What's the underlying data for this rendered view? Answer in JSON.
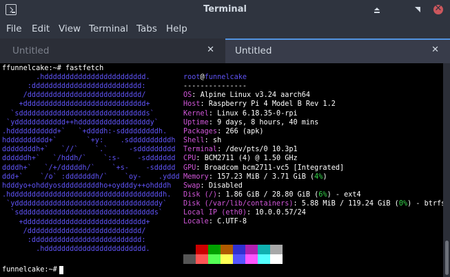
{
  "window": {
    "title": "Terminal"
  },
  "menu": [
    "File",
    "Edit",
    "View",
    "Terminal",
    "Tabs",
    "Help"
  ],
  "tabs": [
    {
      "label": "Untitled",
      "active": false
    },
    {
      "label": "Untitled",
      "active": true
    }
  ],
  "terminal": {
    "command_line": "ffunnelcake:~# fastfetch",
    "prompt": "funnelcake:~#",
    "logo_lines": [
      "        .hdddddddddddddddddddddddd.",
      "      :dddddddddddddddddddddddddd:",
      "     /ddddddddddddddddddddddddddd/",
      "    +ddddddddddddddddddddddddddddd+",
      "  `sdddddddddddddddddddddddddddddds`",
      " `ydddddddddddd++hdddddddddddddddddy`",
      ".hddddddddddd+`   `+ddddh:-sdddddddddh.",
      "hdddddddddd+`       `+y:    .sddddddddddh",
      "ddddddddh+`   `//`    `.`     -sddddddddd",
      "ddddddh+`   `/hddh/`    `:s-    -sddddddd",
      "ddddh+`   `/+/dddddh/`    `+s-    -sddddd",
      "ddd+`    `/o` :dddddddh/`    `oy-    .yddd",
      "hdddyo+ohddyosdddddddddho+oydddy++ohdddh",
      ".hddddddddddddddddddddddddddddddddddddh.",
      " `yddddddddddddddddddddddddddddddddddy`",
      "  `sdddddddddddddddddddddddddddddddds`",
      "    +ddddddddddddddddddddddddddddd+",
      "     /ddddddddddddddddddddddddddd/",
      "      :dddddddddddddddddddddddddd:",
      "        .hdddddddddddddddddddddddd."
    ],
    "info": {
      "user": "root",
      "at": "@",
      "host": "funnelcake",
      "separator": "---------------",
      "rows": [
        {
          "key": "OS",
          "value": "Alpine Linux v3.24 aarch64"
        },
        {
          "key": "Host",
          "value": "Raspberry Pi 4 Model B Rev 1.2"
        },
        {
          "key": "Kernel",
          "value": "Linux 6.18.35-0-rpi"
        },
        {
          "key": "Uptime",
          "value": "9 days, 8 hours, 40 mins"
        },
        {
          "key": "Packages",
          "value": "266 (apk)"
        },
        {
          "key": "Shell",
          "value": "sh"
        },
        {
          "key": "Terminal",
          "value": "/dev/pts/0 10.3p1"
        },
        {
          "key": "CPU",
          "value": "BCM2711 (4) @ 1.50 GHz"
        },
        {
          "key": "GPU",
          "value": "Broadcom bcm2711-vc5 [Integrated]"
        },
        {
          "key": "Memory",
          "value": "157.23 MiB / 3.71 GiB (",
          "pct": "4%",
          "tail": ")"
        },
        {
          "key": "Swap",
          "value": "Disabled"
        },
        {
          "key": "Disk (/)",
          "value": "1.86 GiB / 28.80 GiB (",
          "pct": "6%",
          "tail": ") - ext4"
        },
        {
          "key": "Disk (/var/lib/containers)",
          "value": "5.88 MiB / 119.24 GiB (",
          "pct": "0%",
          "tail": ") - btrfs"
        },
        {
          "key": "Local IP (eth0)",
          "value": "10.0.0.57/24"
        },
        {
          "key": "Locale",
          "value": "C.UTF-8"
        }
      ]
    },
    "palette_top": [
      "#000000",
      "#cc0000",
      "#00a000",
      "#b05a00",
      "#3030d0",
      "#b020b0",
      "#10b0b0",
      "#a8a8a8"
    ],
    "palette_bottom": [
      "#555555",
      "#ff5555",
      "#55ff55",
      "#ffff55",
      "#5555ff",
      "#ff55ff",
      "#55ffff",
      "#ffffff"
    ]
  }
}
